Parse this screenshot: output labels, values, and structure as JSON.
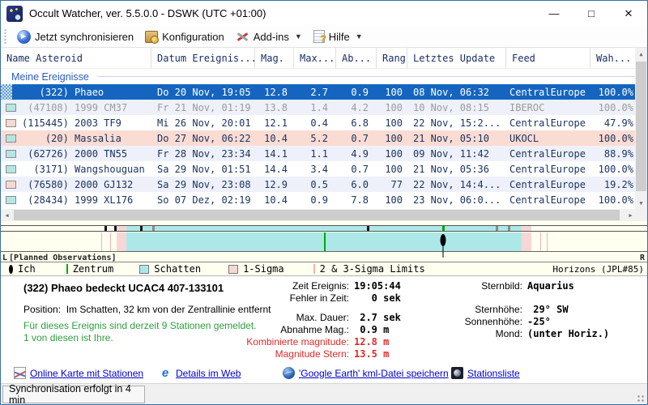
{
  "window": {
    "title": "Occult Watcher, ver. 5.5.0.0 - DSWK (UTC +01:00)"
  },
  "toolbar": {
    "sync_label": "Jetzt synchronisieren",
    "config_label": "Konfiguration",
    "addins_label": "Add-ins",
    "help_label": "Hilfe"
  },
  "table": {
    "headers": [
      "Name Asteroid",
      "Datum Ereignis...",
      "Mag.",
      "Max...",
      "Ab...",
      "Rang",
      "Letztes Update",
      "Feed",
      "Wah..."
    ],
    "group_label": "Meine Ereignisse",
    "rows": [
      {
        "icon": "hatch",
        "bg": "selected",
        "txt": "selected",
        "name": "   (322) Phaeo",
        "datum": "Do 20 Nov, 19:05",
        "mag": "12.8",
        "max": "2.7",
        "ab": "0.9",
        "rang": "100",
        "update": "08 Nov, 06:32",
        "feed": "CentralEurope",
        "wah": "100.0%"
      },
      {
        "icon": "teal",
        "bg": "alt",
        "txt": "dim",
        "name": " (47108) 1999 CM37",
        "datum": "Fr 21 Nov, 01:19",
        "mag": "13.8",
        "max": "1.4",
        "ab": "4.2",
        "rang": "100",
        "update": "10 Nov, 08:15",
        "feed": "IBEROC",
        "wah": "100.0%"
      },
      {
        "icon": "pink",
        "bg": "white",
        "txt": "normal",
        "name": "(115445) 2003 TF9",
        "datum": "Mi 26 Nov, 20:01",
        "mag": "12.1",
        "max": "0.4",
        "ab": "6.8",
        "rang": "100",
        "update": "22 Nov, 15:2...",
        "feed": "CentralEurope",
        "wah": "47.9%"
      },
      {
        "icon": "teal",
        "bg": "pink",
        "txt": "normal",
        "name": "    (20) Massalia",
        "datum": "Do 27 Nov, 06:22",
        "mag": "10.4",
        "max": "5.2",
        "ab": "0.7",
        "rang": "100",
        "update": "21 Nov, 05:10",
        "feed": "UKOCL",
        "wah": "100.0%"
      },
      {
        "icon": "teal",
        "bg": "alt",
        "txt": "normal",
        "name": " (62726) 2000 TN55",
        "datum": "Fr 28 Nov, 23:34",
        "mag": "14.1",
        "max": "1.1",
        "ab": "4.9",
        "rang": "100",
        "update": "09 Nov, 11:42",
        "feed": "CentralEurope",
        "wah": "88.9%"
      },
      {
        "icon": "teal",
        "bg": "white",
        "txt": "normal",
        "name": "  (3171) Wangshouguan",
        "datum": "Sa 29 Nov, 01:51",
        "mag": "14.4",
        "max": "3.4",
        "ab": "0.7",
        "rang": "100",
        "update": "21 Nov, 05:36",
        "feed": "CentralEurope",
        "wah": "100.0%"
      },
      {
        "icon": "pink",
        "bg": "alt",
        "txt": "normal",
        "name": " (76580) 2000 GJ132",
        "datum": "Sa 29 Nov, 23:08",
        "mag": "12.9",
        "max": "0.5",
        "ab": "6.0",
        "rang": "77",
        "update": "22 Nov, 14:4...",
        "feed": "CentralEurope",
        "wah": "19.2%"
      },
      {
        "icon": "teal",
        "bg": "white",
        "txt": "normal",
        "name": " (28434) 1999 XL176",
        "datum": "So 07 Dez, 02:19",
        "mag": "10.4",
        "max": "0.9",
        "ab": "7.8",
        "rang": "100",
        "update": "23 Nov, 06:0...",
        "feed": "CentralEurope",
        "wah": "100.0%"
      }
    ]
  },
  "graph": {
    "edge_left": "L",
    "edge_title": "[Planned Observations]",
    "edge_right": "R",
    "colors": {
      "shadow": "#ace8e8",
      "sigma1": "#f8d6d6",
      "sigma_line": "#f0b4b4",
      "cream": "#fffff0",
      "center_green": "#00a800",
      "tick_black": "#111111",
      "tick_gray": "#8a8a8a"
    },
    "band_segments": [
      {
        "from": 17.9,
        "to": 19.4,
        "color": "sigma1"
      },
      {
        "from": 19.4,
        "to": 80.6,
        "color": "shadow"
      },
      {
        "from": 80.6,
        "to": 82.1,
        "color": "sigma1"
      }
    ],
    "sigma_lines_pct": [
      15.6,
      16.9,
      83.4,
      84.5
    ],
    "center_pct": 50,
    "me_pct": 68.4,
    "strip_ticks": [
      {
        "pos": 16.0,
        "color": "tick_black"
      },
      {
        "pos": 17.5,
        "color": "tick_black"
      },
      {
        "pos": 21.5,
        "color": "tick_black"
      },
      {
        "pos": 23.4,
        "color": "tick_gray"
      },
      {
        "pos": 56.6,
        "color": "tick_black"
      },
      {
        "pos": 68.3,
        "color": "center_green"
      },
      {
        "pos": 76.6,
        "color": "tick_gray"
      },
      {
        "pos": 78.4,
        "color": "tick_gray"
      }
    ],
    "legend": {
      "ich": "Ich",
      "zentrum": "Zentrum",
      "schatten": "Schatten",
      "sigma1": "1-Sigma",
      "sigma23": "2 & 3-Sigma Limits",
      "source": "Horizons (JPL#85)"
    }
  },
  "details": {
    "title": "(322) Phaeo bedeckt  UCAC4 407-133101",
    "position_label": "Position:",
    "position_value": "Im Schatten, 32 km von der Zentrallinie entfernt",
    "stations_line1": "Für dieses Ereignis sind derzeit 9 Stationen gemeldet.",
    "stations_line2": "1 von diesen ist Ihre.",
    "mid_rows": [
      {
        "label": "Zeit Ereignis:",
        "value": "19:05:44",
        "style": "normal"
      },
      {
        "label": "Fehler in Zeit:",
        "value": "   0 sek",
        "style": "normal"
      },
      {
        "label": "Max. Dauer:",
        "value": " 2.7 sek",
        "style": "gap"
      },
      {
        "label": "Abnahme Mag.:",
        "value": " 0.9 m",
        "style": "normal"
      },
      {
        "label": "Kombinierte magnitude:",
        "value": "12.8 m",
        "style": "red"
      },
      {
        "label": "Magnitude Stern:",
        "value": "13.5 m",
        "style": "red"
      }
    ],
    "right_rows": [
      {
        "label": "Sternbild:",
        "value": "Aquarius",
        "style": "normal"
      },
      {
        "label": "Sternhöhe:",
        "value": " 29° SW",
        "style": "bigger-gap"
      },
      {
        "label": "Sonnenhöhe:",
        "value": "-25°",
        "style": "normal"
      },
      {
        "label": "Mond:",
        "value": "(unter Horiz.)",
        "style": "normal"
      }
    ]
  },
  "links": [
    {
      "label": "Online Karte mit Stationen"
    },
    {
      "label": "Details im Web"
    },
    {
      "label": "'Google Earth' kml-Datei speichern"
    },
    {
      "label": "Stationsliste"
    }
  ],
  "statusbar": {
    "text": "Synchronisation erfolgt in 4 min"
  },
  "window_controls": {
    "minimize": "—",
    "maximize": "□",
    "close": "✕"
  }
}
